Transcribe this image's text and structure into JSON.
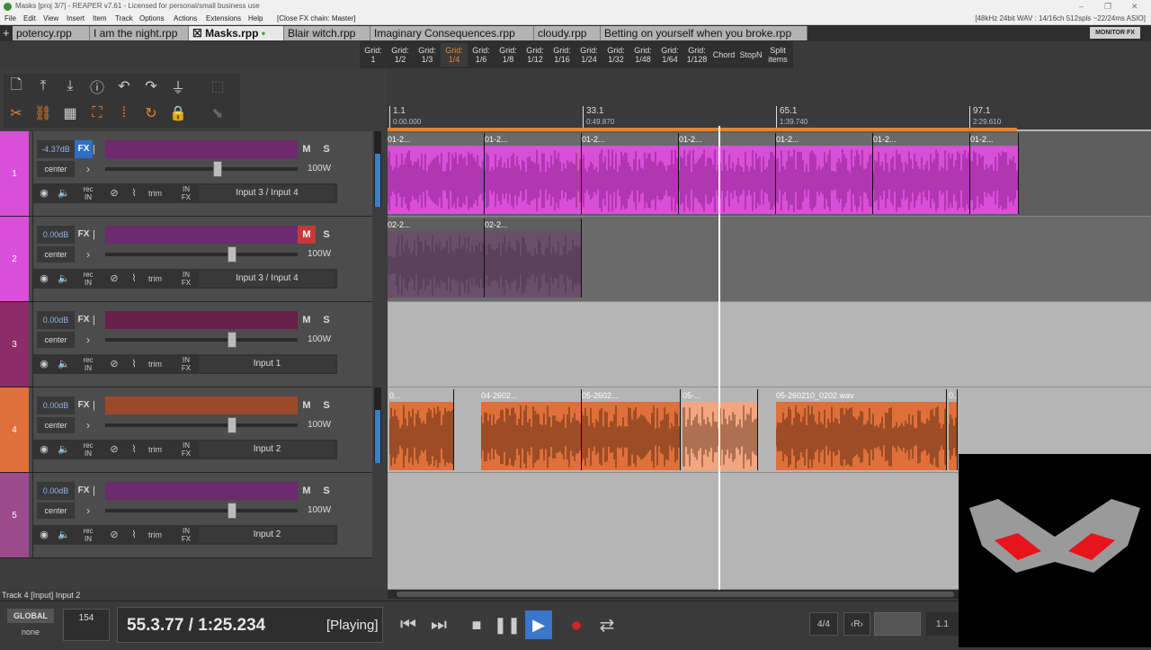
{
  "window": {
    "title": "Masks [proj 3/7] - REAPER v7.61 - Licensed for personal/small business use",
    "controls": [
      "–",
      "❐",
      "✕"
    ]
  },
  "menu": {
    "items": [
      "File",
      "Edit",
      "View",
      "Insert",
      "Item",
      "Track",
      "Options",
      "Actions",
      "Extensions",
      "Help",
      "[Close FX chain: Master]"
    ],
    "audio_status": "[48kHz 24bit WAV : 14/16ch 512spls ~22/24ms ASIO]"
  },
  "project_tabs": [
    {
      "label": "potency.rpp",
      "active": false
    },
    {
      "label": "I am the night.rpp",
      "active": false
    },
    {
      "label": "Masks.rpp",
      "active": true,
      "prefix": "☒",
      "suffix": "•"
    },
    {
      "label": "Blair witch.rpp",
      "active": false
    },
    {
      "label": "Imaginary Consequences.rpp",
      "active": false
    },
    {
      "label": "cloudy.rpp",
      "active": false
    },
    {
      "label": "Betting on yourself when you broke.rpp",
      "active": false
    }
  ],
  "new_tab_button": "+",
  "monitor_fx": "MONITOR FX",
  "grid_toolbar": {
    "buttons": [
      "Grid:\n1",
      "Grid:\n1/2",
      "Grid:\n1/3",
      "Grid:\n1/4",
      "Grid:\n1/6",
      "Grid:\n1/8",
      "Grid:\n1/12",
      "Grid:\n1/16",
      "Grid:\n1/24",
      "Grid:\n1/32",
      "Grid:\n1/48",
      "Grid:\n1/64",
      "Grid:\n1/128",
      "Chord",
      "StopN",
      "Split\nitems"
    ],
    "selected_index": 3
  },
  "tracks": [
    {
      "number": "1",
      "color": "#d84fd8",
      "volume": "-4.37dB",
      "fx_active": true,
      "mute": false,
      "pan": "center",
      "width": "100W",
      "input": "Input 3 / Input 4",
      "fader_level": 0.6
    },
    {
      "number": "2",
      "color": "#d84fd8",
      "volume": "0.00dB",
      "fx_active": false,
      "mute": true,
      "pan": "center",
      "width": "100W",
      "input": "Input 3 / Input 4",
      "fader_level": 0.68
    },
    {
      "number": "3",
      "color": "#8e2c6a",
      "volume": "0.00dB",
      "fx_active": false,
      "mute": false,
      "pan": "center",
      "width": "100W",
      "input": "Input 1",
      "fader_level": 0.68
    },
    {
      "number": "4",
      "color": "#e0703a",
      "volume": "0.00dB",
      "fx_active": false,
      "mute": false,
      "pan": "center",
      "width": "100W",
      "input": "Input 2",
      "fader_level": 0.68
    },
    {
      "number": "5",
      "color": "#9c4a8e",
      "volume": "0.00dB",
      "fx_active": false,
      "mute": false,
      "pan": "center",
      "width": "100W",
      "input": "Input 2",
      "fader_level": 0.68
    }
  ],
  "track_labels": {
    "fx": "FX",
    "mute": "M",
    "solo": "S",
    "rec_in": "rec\nIN",
    "in_fx": "IN\nFX",
    "trim": "trim"
  },
  "ruler": [
    {
      "bar": "1.1",
      "time": "0:00.000"
    },
    {
      "bar": "33.1",
      "time": "0:49.870"
    },
    {
      "bar": "65.1",
      "time": "1:39.740"
    },
    {
      "bar": "97.1",
      "time": "2:29.610"
    }
  ],
  "items_track4": [
    "0...",
    "04-2602...",
    "05-2602...",
    "05-...",
    "05-260210_0202.wav"
  ],
  "items_track1": "01-2...",
  "items_track2": "02-2...",
  "status_line": "Track 4 [Input] Input 2",
  "transport": {
    "global": "GLOBAL",
    "global_sub": "none",
    "bpm": "154",
    "position": "55.3.77 / 1:25.234",
    "state": "[Playing]",
    "time_sig": "4/4",
    "rate": "‹R›",
    "loop_pos": "1.1"
  }
}
